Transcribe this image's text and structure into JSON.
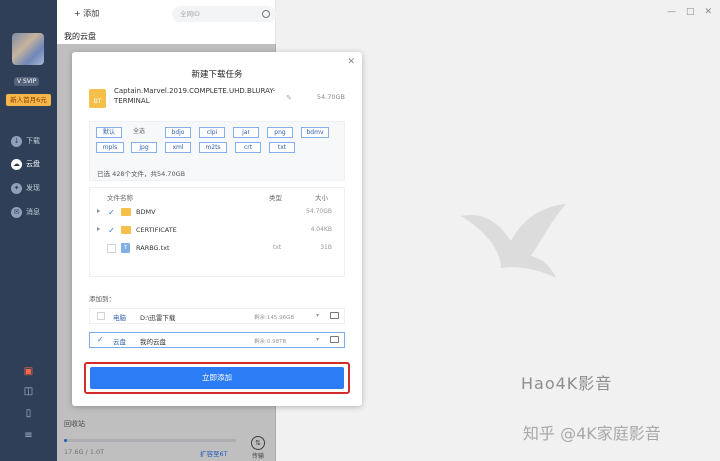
{
  "sidebar": {
    "add_label": "+ 添加",
    "search_placeholder": "全网ID",
    "my_cloud": "我的云盘",
    "recycle": "回收站",
    "quota_text": "17.6G / 1.0T",
    "quota_used_fraction": 0.018,
    "expand": "扩容至6T",
    "transfer": "传输"
  },
  "rail": {
    "vip": "V SVIP",
    "promo": "新人首月6元",
    "items": [
      {
        "label": "下载",
        "icon": "download-icon"
      },
      {
        "label": "云盘",
        "icon": "cloud-icon",
        "active": true
      },
      {
        "label": "发现",
        "icon": "compass-icon"
      },
      {
        "label": "消息",
        "icon": "message-icon"
      }
    ]
  },
  "dialog": {
    "title": "新建下载任务",
    "file_name": "Captain.Marvel.2019.COMPLETE.UHD.BLURAY-TERMINAL",
    "file_size": "54.70GB",
    "file_icon_text": "BT",
    "filters": [
      "默认",
      "全选",
      "bdjo",
      "clpi",
      "jar",
      "png",
      "bdmv",
      "mpls",
      "jpg",
      "xml",
      "m2ts",
      "crt",
      "txt"
    ],
    "selection_info": "已选 428个文件，共54.70GB",
    "table_headers": {
      "name": "文件名称",
      "type": "类型",
      "size": "大小"
    },
    "files": [
      {
        "name": "BDMV",
        "type": "",
        "size": "54.70GB",
        "kind": "folder",
        "checked": true
      },
      {
        "name": "CERTIFICATE",
        "type": "",
        "size": "4.04KB",
        "kind": "folder",
        "checked": true
      },
      {
        "name": "RARBG.txt",
        "type": "txt",
        "size": "31B",
        "kind": "txt",
        "checked": false
      }
    ],
    "add_to_label": "添加到：",
    "destinations": [
      {
        "label": "电脑",
        "path": "D:\\迅雷下载",
        "free": "剩余:145.96GB",
        "selected": false
      },
      {
        "label": "云盘",
        "path": "我的云盘",
        "free": "剩余:0.98TB",
        "selected": true
      }
    ],
    "submit_label": "立即添加"
  },
  "watermark": {
    "line1": "Hao4K影音",
    "line2": "知乎 @4K家庭影音"
  },
  "colors": {
    "accent": "#2c7cf6",
    "highlight": "#d42b2b",
    "rail": "#2f3f57"
  }
}
